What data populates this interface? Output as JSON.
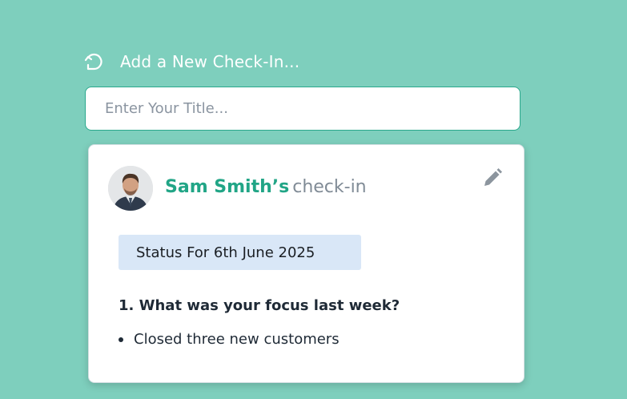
{
  "header": {
    "icon": "refresh-chat-icon",
    "title": "Add a New Check-In..."
  },
  "title_input": {
    "placeholder": "Enter Your Title...",
    "value": ""
  },
  "card": {
    "author_name": "Sam Smith’s",
    "title_suffix": "check-in",
    "edit_icon": "pencil-icon",
    "status_label": "Status For 6th June 2025",
    "question": "1. What was your focus last week?",
    "answers": [
      "Closed three new customers"
    ]
  },
  "colors": {
    "background": "#7ecfbd",
    "accent": "#21a586",
    "status_bg": "#d9e7f7"
  }
}
